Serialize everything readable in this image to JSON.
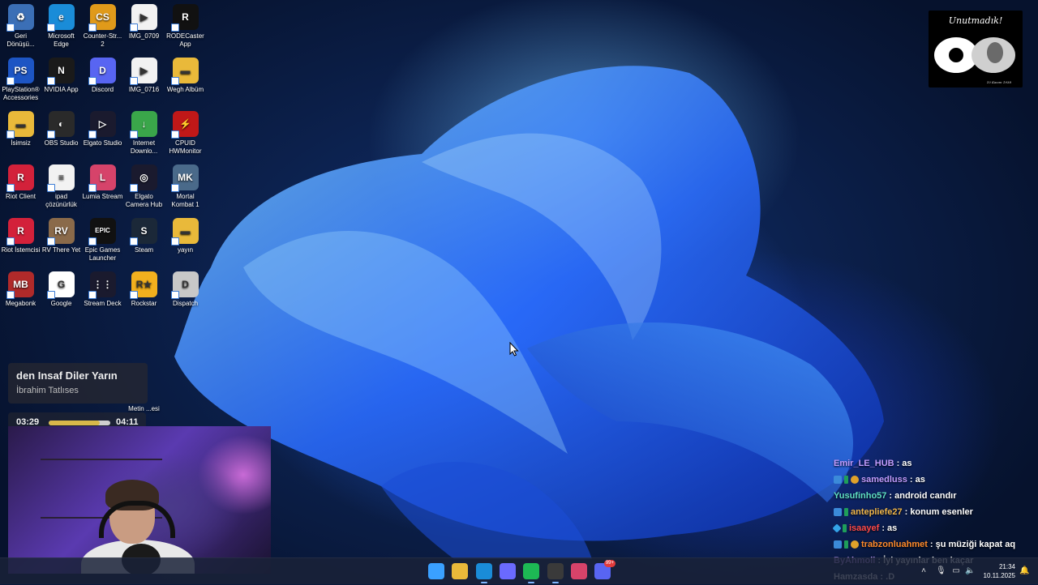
{
  "desktop": {
    "icons": [
      {
        "label": "Geri Dönüşü...",
        "color": "#3b6fb6",
        "glyph": "♻",
        "name": "recycle-bin-icon"
      },
      {
        "label": "Microsoft Edge",
        "color": "#1a8cd8",
        "glyph": "e",
        "name": "edge-icon"
      },
      {
        "label": "Counter-Str... 2",
        "color": "#e09a1a",
        "glyph": "CS",
        "name": "counter-strike-icon"
      },
      {
        "label": "IMG_0709",
        "color": "#f2f2f2",
        "glyph": "▶",
        "name": "video-file-icon"
      },
      {
        "label": "RODECaster App",
        "color": "#111111",
        "glyph": "R",
        "name": "rodecaster-icon"
      },
      {
        "label": "PlayStation® Accessories",
        "color": "#1d55c4",
        "glyph": "PS",
        "name": "playstation-icon"
      },
      {
        "label": "NVIDIA App",
        "color": "#1a1a1a",
        "glyph": "N",
        "name": "nvidia-icon"
      },
      {
        "label": "Discord",
        "color": "#5865f2",
        "glyph": "D",
        "name": "discord-icon"
      },
      {
        "label": "IMG_0716",
        "color": "#f2f2f2",
        "glyph": "▶",
        "name": "video-file-icon"
      },
      {
        "label": "Wegh Albüm",
        "color": "#e9b93a",
        "glyph": "▬",
        "name": "folder-icon"
      },
      {
        "label": "İsimsiz",
        "color": "#e9b93a",
        "glyph": "▬",
        "name": "folder-icon"
      },
      {
        "label": "OBS Studio",
        "color": "#2a2a2a",
        "glyph": "◐",
        "name": "obs-icon"
      },
      {
        "label": "Elgato Studio",
        "color": "#1a1a2e",
        "glyph": "▷",
        "name": "elgato-studio-icon"
      },
      {
        "label": "Internet Downlo...",
        "color": "#3aa64a",
        "glyph": "↓",
        "name": "idm-icon"
      },
      {
        "label": "CPUID HWMonitor",
        "color": "#c01818",
        "glyph": "⚡",
        "name": "hwmonitor-icon"
      },
      {
        "label": "Riot Client",
        "color": "#d3213a",
        "glyph": "R",
        "name": "riot-client-icon"
      },
      {
        "label": "ipad çözünürlük",
        "color": "#f2f2f2",
        "glyph": "≡",
        "name": "text-file-icon"
      },
      {
        "label": "Lumia Stream",
        "color": "#d6436a",
        "glyph": "L",
        "name": "lumia-stream-icon"
      },
      {
        "label": "Elgato Camera Hub",
        "color": "#1a1a2e",
        "glyph": "◎",
        "name": "camera-hub-icon"
      },
      {
        "label": "Mortal Kombat 1",
        "color": "#4a6a8a",
        "glyph": "MK",
        "name": "mortal-kombat-icon"
      },
      {
        "label": "Riot İstemcisi",
        "color": "#d3213a",
        "glyph": "R",
        "name": "riot-client-icon"
      },
      {
        "label": "RV There Yet",
        "color": "#8a6a4a",
        "glyph": "RV",
        "name": "rv-there-yet-icon"
      },
      {
        "label": "Epic Games Launcher",
        "color": "#111111",
        "glyph": "EPIC",
        "name": "epic-games-icon"
      },
      {
        "label": "Steam",
        "color": "#1b2838",
        "glyph": "S",
        "name": "steam-icon"
      },
      {
        "label": "yayın",
        "color": "#e9b93a",
        "glyph": "▬",
        "name": "folder-icon"
      },
      {
        "label": "Megabonk",
        "color": "#b02a2a",
        "glyph": "MB",
        "name": "megabonk-icon"
      },
      {
        "label": "Google",
        "color": "#ffffff",
        "glyph": "G",
        "name": "chrome-icon"
      },
      {
        "label": "Stream Deck",
        "color": "#1a1a2e",
        "glyph": "⋮⋮",
        "name": "stream-deck-icon"
      },
      {
        "label": "Rockstar",
        "color": "#f2b01e",
        "glyph": "R★",
        "name": "rockstar-icon"
      },
      {
        "label": "Dispatch",
        "color": "#c8c8c8",
        "glyph": "D",
        "name": "dispatch-icon"
      }
    ],
    "partial_icon_label": "Metin ...esi"
  },
  "logo_card": {
    "text": "Unutmadık!",
    "signature": "10 Kasım 1938"
  },
  "music": {
    "title": "den Insaf Diler Yarın",
    "artist": "İbrahim Tatlıses",
    "elapsed": "03:29",
    "total": "04:11",
    "progress": 0.83
  },
  "chat": [
    {
      "badges": [],
      "user": "Emir_LE_HUB",
      "user_color": "#c19cff",
      "text": ": as"
    },
    {
      "badges": [
        "prime",
        "sub",
        "bits"
      ],
      "user": "samedluss",
      "user_color": "#c19cff",
      "text": ": as"
    },
    {
      "badges": [],
      "user": "Yusufinho57",
      "user_color": "#5fe0c4",
      "text": ": android candır"
    },
    {
      "badges": [
        "prime",
        "sub"
      ],
      "user": "antepliefe27",
      "user_color": "#f0b64a",
      "text": ": konum esenler"
    },
    {
      "badges": [
        "gem",
        "sub"
      ],
      "user": "isaayef",
      "user_color": "#ff4a4a",
      "text": ": as"
    },
    {
      "badges": [
        "prime",
        "sub",
        "bits"
      ],
      "user": "trabzonluahmet",
      "user_color": "#ff8a2a",
      "text": ": şu müziği kapat aq"
    },
    {
      "badges": [],
      "user": "ByAhmoli",
      "user_color": "#c19cff",
      "text": ": İyi yayınlar ben kaçar"
    },
    {
      "badges": [],
      "user": "Hamzasda",
      "user_color": "#ffffff",
      "text": ": .D"
    }
  ],
  "taskbar": {
    "apps": [
      {
        "name": "start-button",
        "color": "#3aa0ff",
        "active": false
      },
      {
        "name": "file-explorer-icon",
        "color": "#e9b93a",
        "active": false
      },
      {
        "name": "edge-taskbar-icon",
        "color": "#1a8cd8",
        "active": true
      },
      {
        "name": "store-icon",
        "color": "#6a6aff",
        "active": false
      },
      {
        "name": "spotify-icon",
        "color": "#1db954",
        "active": true
      },
      {
        "name": "obs-taskbar-icon",
        "color": "#3a3a3a",
        "active": true
      },
      {
        "name": "lumia-taskbar-icon",
        "color": "#d6436a",
        "active": false
      },
      {
        "name": "discord-taskbar-icon",
        "color": "#5865f2",
        "active": false
      }
    ],
    "discord_badge": "99+",
    "time": "21:34",
    "date": "10.11.2025"
  }
}
